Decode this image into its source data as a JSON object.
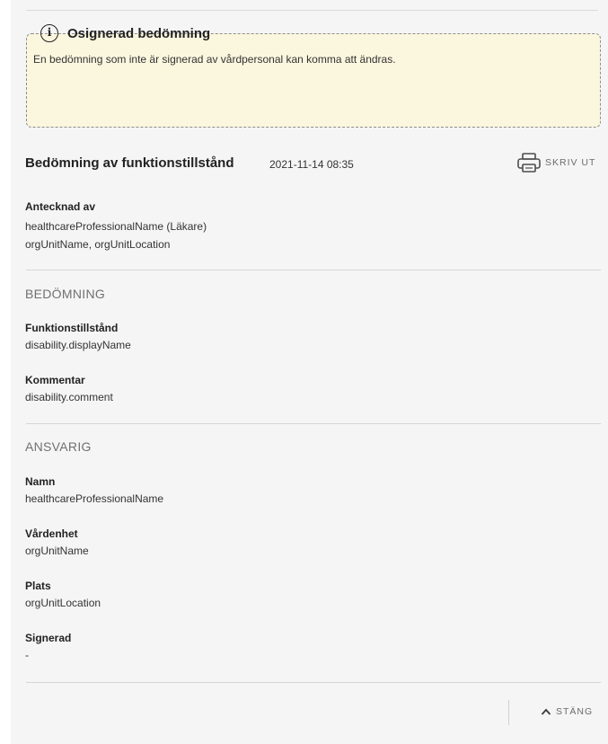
{
  "alert": {
    "icon": "info-icon",
    "icon_glyph": "i",
    "title": "Osignerad bedömning",
    "text": "En bedömning som inte är signerad av vårdpersonal kan komma att ändras."
  },
  "header": {
    "title": "Bedömning av funktionstillstånd",
    "date": "2021-11-14 08:35",
    "print_label": "SKRIV UT",
    "print_icon": "printer-icon"
  },
  "noted_by": {
    "label": "Antecknad av",
    "line1": "healthcareProfessionalName (Läkare)",
    "line2": "orgUnitName, orgUnitLocation"
  },
  "assessment": {
    "heading": "BEDÖMNING",
    "fields": [
      {
        "label": "Funktionstillstånd",
        "value": "disability.displayName"
      },
      {
        "label": "Kommentar",
        "value": "disability.comment"
      }
    ]
  },
  "responsible": {
    "heading": "ANSVARIG",
    "fields": [
      {
        "label": "Namn",
        "value": "healthcareProfessionalName"
      },
      {
        "label": "Vårdenhet",
        "value": "orgUnitName"
      },
      {
        "label": "Plats",
        "value": "orgUnitLocation"
      },
      {
        "label": "Signerad",
        "value": "-"
      }
    ]
  },
  "footer": {
    "close_label": "STÄNG",
    "close_icon": "chevron-up-icon"
  },
  "colors": {
    "alert_background": "#fbf6de",
    "panel_background": "#f5f5f6",
    "muted_text": "#6b6b6b"
  }
}
